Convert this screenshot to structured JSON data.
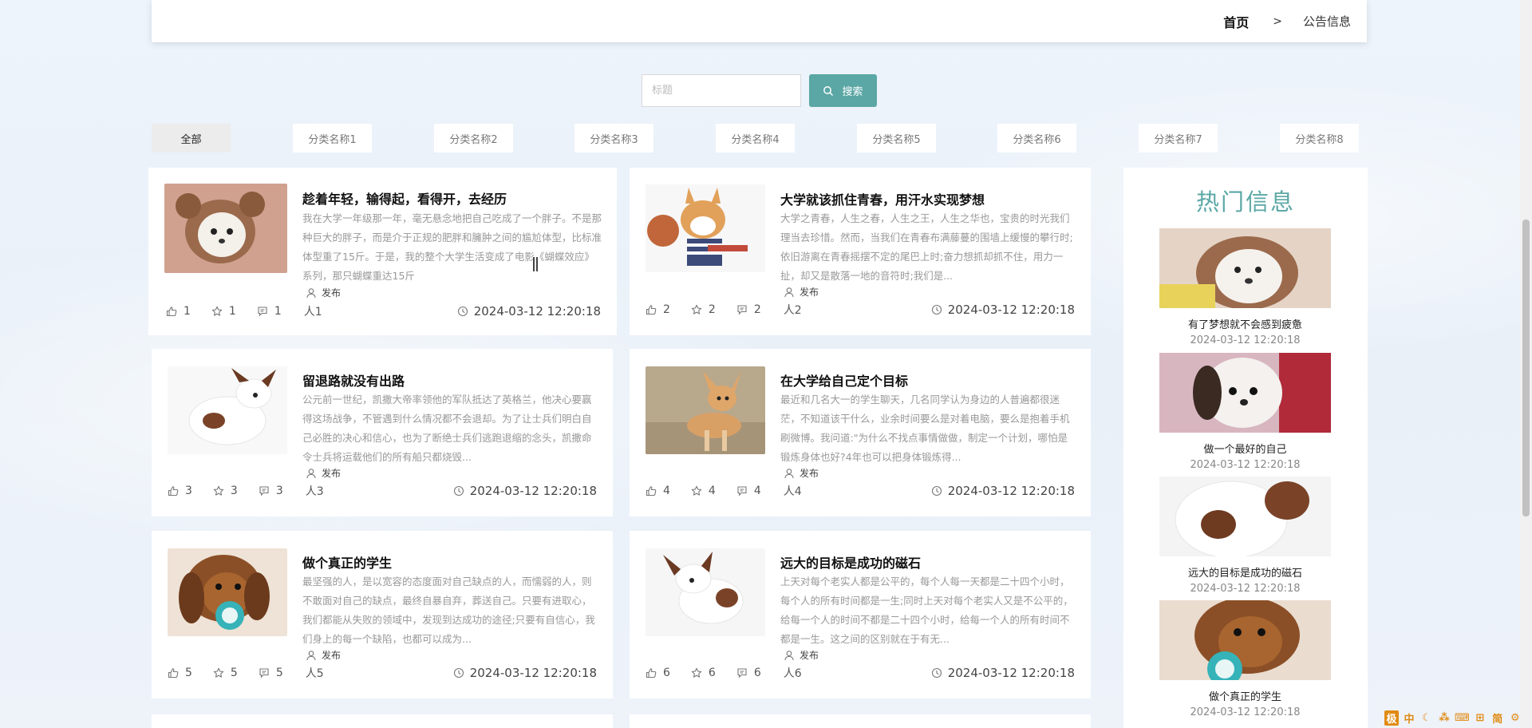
{
  "breadcrumb": {
    "home": "首页",
    "separator": ">",
    "current": "公告信息"
  },
  "search": {
    "placeholder": "标题",
    "button_label": "搜索"
  },
  "categories": [
    "全部",
    "分类名称1",
    "分类名称2",
    "分类名称3",
    "分类名称4",
    "分类名称5",
    "分类名称6",
    "分类名称7",
    "分类名称8"
  ],
  "colors": {
    "accent": "#5aa7a5",
    "active_tab": "#ececec"
  },
  "articles": [
    {
      "title": "趁着年轻，输得起，看得开，去经历",
      "excerpt": "我在大学一年级那一年，毫无悬念地把自己吃成了一个胖子。不是那种巨大的胖子，而是介于正规的肥胖和臃肿之间的尴尬体型，比标准体型重了15斤。于是，我的整个大学生活变成了电影《蝴蝶效应》系列，那只蝴蝶重达15斤",
      "publish": "发布",
      "likes": "1",
      "stars": "1",
      "comments": "1",
      "author": "人1",
      "time": "2024-03-12 12:20:18"
    },
    {
      "title": "大学就该抓住青春，用汗水实现梦想",
      "excerpt": "大学之青春，人生之春，人生之王，人生之华也，宝贵的时光我们理当去珍惜。然而，当我们在青春布满藤蔓的围墙上缓慢的攀行时;依旧游离在青春摇摆不定的尾巴上时;奋力想抓却抓不住，用力一扯，却又是散落一地的音符时;我们是...",
      "publish": "发布",
      "likes": "2",
      "stars": "2",
      "comments": "2",
      "author": "人2",
      "time": "2024-03-12 12:20:18"
    },
    {
      "title": "留退路就没有出路",
      "excerpt": "公元前一世纪，凯撒大帝率领他的军队抵达了英格兰，他决心要赢得这场战争，不管遇到什么情况都不会退却。为了让士兵们明白自己必胜的决心和信心，也为了断绝士兵们逃跑退缩的念头，凯撒命令士兵将运载他们的所有船只都烧毁...",
      "publish": "发布",
      "likes": "3",
      "stars": "3",
      "comments": "3",
      "author": "人3",
      "time": "2024-03-12 12:20:18"
    },
    {
      "title": "在大学给自己定个目标",
      "excerpt": "最近和几名大一的学生聊天，几名同学认为身边的人普遍都很迷茫，不知道该干什么，业余时间要么是对着电脑，要么是抱着手机刷微博。我问道:\"为什么不找点事情做做，制定一个计划，哪怕是锻炼身体也好?4年也可以把身体锻炼得...",
      "publish": "发布",
      "likes": "4",
      "stars": "4",
      "comments": "4",
      "author": "人4",
      "time": "2024-03-12 12:20:18"
    },
    {
      "title": "做个真正的学生",
      "excerpt": "最坚强的人，是以宽容的态度面对自己缺点的人，而懦弱的人，则不敢面对自己的缺点，最终自暴自弃，葬送自己。只要有进取心，我们都能从失败的领域中，发现到达成功的途径;只要有自信心，我们身上的每一个缺陷，也都可以成为...",
      "publish": "发布",
      "likes": "5",
      "stars": "5",
      "comments": "5",
      "author": "人5",
      "time": "2024-03-12 12:20:18"
    },
    {
      "title": "远大的目标是成功的磁石",
      "excerpt": "上天对每个老实人都是公平的，每个人每一天都是二十四个小时，每个人的所有时间都是一生;同时上天对每个老实人又是不公平的，给每一个人的时间不都是二十四个小时，给每一个人的所有时间不都是一生。这之间的区别就在于有无...",
      "publish": "发布",
      "likes": "6",
      "stars": "6",
      "comments": "6",
      "author": "人6",
      "time": "2024-03-12 12:20:18"
    }
  ],
  "hot": {
    "title": "热门信息",
    "items": [
      {
        "title": "有了梦想就不会感到疲惫",
        "time": "2024-03-12 12:20:18"
      },
      {
        "title": "做一个最好的自己",
        "time": "2024-03-12 12:20:18"
      },
      {
        "title": "远大的目标是成功的磁石",
        "time": "2024-03-12 12:20:18"
      },
      {
        "title": "做个真正的学生",
        "time": "2024-03-12 12:20:18"
      }
    ]
  },
  "ime": {
    "items": [
      "极",
      "中",
      "☾",
      "⁂",
      "⌨",
      "⊞",
      "简",
      "⚙"
    ]
  }
}
